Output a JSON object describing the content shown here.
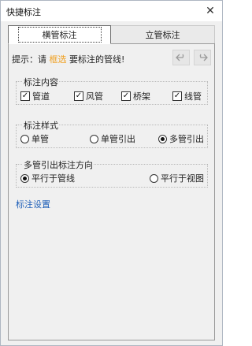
{
  "window": {
    "title": "快捷标注",
    "close_glyph": "✕"
  },
  "tabs": [
    {
      "label": "横管标注",
      "active": true
    },
    {
      "label": "立管标注",
      "active": false
    }
  ],
  "hint": {
    "prefix": "提示：请 ",
    "pick": "框选",
    "suffix": " 要标注的管线!"
  },
  "toolbar": {
    "undo_icon": "undo-icon",
    "redo_icon": "redo-icon"
  },
  "content_group": {
    "label": "标注内容",
    "options": [
      {
        "label": "管道",
        "checked": true
      },
      {
        "label": "风管",
        "checked": true
      },
      {
        "label": "桥架",
        "checked": true
      },
      {
        "label": "线管",
        "checked": true
      }
    ]
  },
  "style_group": {
    "label": "标注样式",
    "options": [
      {
        "label": "单管",
        "selected": false
      },
      {
        "label": "单管引出",
        "selected": false
      },
      {
        "label": "多管引出",
        "selected": true
      }
    ]
  },
  "direction_group": {
    "label": "多管引出标注方向",
    "options": [
      {
        "label": "平行于管线",
        "selected": true
      },
      {
        "label": "平行于视图",
        "selected": false
      }
    ]
  },
  "settings_link": "标注设置",
  "colors": {
    "accent_pick": "#f0a020",
    "link": "#1e5fb8"
  }
}
